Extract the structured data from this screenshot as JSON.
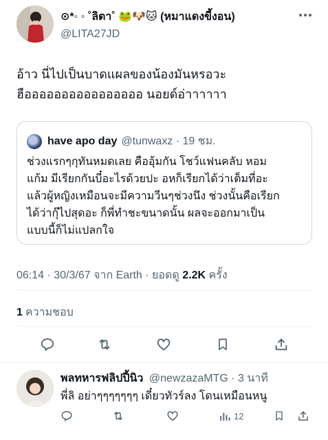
{
  "tweet": {
    "author": {
      "display_name": "⊙*◦ ◦ ˚ลิตา˚ 🐸🐶🐱 (หมาแดงขี้งอน)",
      "handle": "@LITA27JD"
    },
    "text": "อ้าว นี่ไปเป็นบาดแผลของน้องมันหรอวะ\nฮืออออออออออออออออ นอยด์อ่าาาาาา",
    "quote": {
      "name": "have apo day",
      "handle_time": "@tunwaxz · 19 ชม.",
      "text": "ช่วงแรกๆกุทันหมดเลย คืออุ้มกัน โชว์แฟนคลับ หอม\nแก้ม มีเรียกกันบี๋อะไรด้วยปะ อหก็เรียกได้ว่าเต็มที่อะ\nแล้วผู้หญิงเหมือนจะมีความวีนๆช่วงนึง ช่วงนั้นคือเรียก\nได้ว่ากุ๊ไปสุดอะ ก็พี่ทำชะขนาดนั้น ผลจะออกมาเป็น\nแบบนี้ก็ไม่แปลกใจ"
    },
    "meta": {
      "time_date_source": "06:14 · 30/3/67 จาก Earth · ยอดดู ",
      "views": "2.2K",
      "views_suffix": " ครั้ง"
    },
    "likes": {
      "count": "1",
      "label": "ความชอบ"
    }
  },
  "actions": {
    "icons": [
      "reply-icon",
      "retweet-icon",
      "like-icon",
      "bookmark-icon",
      "share-icon"
    ]
  },
  "reply": {
    "name": "พลทหารฟลิปปี้นิว",
    "handle_time": "@newzazaMTG · 3 นาที",
    "text": "พี่ลิ อย่าๆๆๆๆๆๆๆ เดี๋ยวทัวร์ลง โดนเหมือนหนู",
    "views": "12"
  },
  "colors": {
    "text": "#0f1419",
    "secondary": "#536471",
    "border": "#cfd9de",
    "divider": "#eff3f4"
  }
}
